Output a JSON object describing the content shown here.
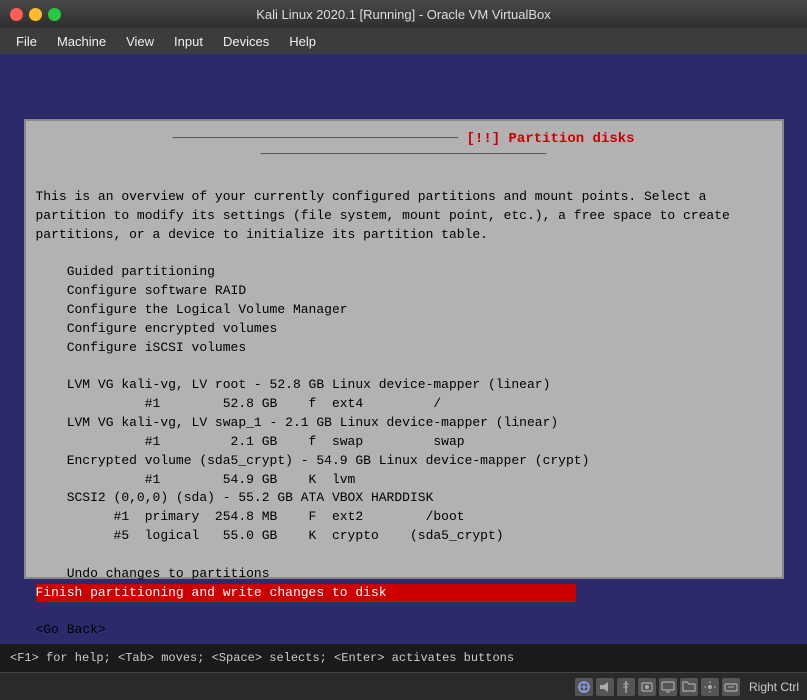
{
  "titlebar": {
    "title": "Kali Linux 2020.1 [Running] - Oracle VM VirtualBox"
  },
  "menubar": {
    "items": [
      "File",
      "Machine",
      "View",
      "Input",
      "Devices",
      "Help"
    ]
  },
  "terminal": {
    "title": "[!!] Partition disks",
    "description": "This is an overview of your currently configured partitions and mount points. Select a\npartition to modify its settings (file system, mount point, etc.), a free space to create\npartitions, or a device to initialize its partition table.",
    "options": [
      "Guided partitioning",
      "Configure software RAID",
      "Configure the Logical Volume Manager",
      "Configure encrypted volumes",
      "Configure iSCSI volumes",
      "",
      "LVM VG kali-vg, LV root - 52.8 GB Linux device-mapper (linear)",
      "        #1        52.8 GB    f  ext4         /",
      "LVM VG kali-vg, LV swap_1 - 2.1 GB Linux device-mapper (linear)",
      "        #1         2.1 GB    f  swap         swap",
      "Encrypted volume (sda5_crypt) - 54.9 GB Linux device-mapper (crypt)",
      "        #1        54.9 GB    K  lvm",
      "SCSI2 (0,0,0) (sda) - 55.2 GB ATA VBOX HARDDISK",
      "        #1  primary  254.8 MB    F  ext2        /boot",
      "        #5  logical   55.0 GB    K  crypto    (sda5_crypt)",
      "",
      "Undo changes to partitions"
    ],
    "highlighted": "Finish partitioning and write changes to disk",
    "go_back": "<Go Back>"
  },
  "statusbar": {
    "text": "<F1> for help; <Tab> moves; <Space> selects; <Enter> activates buttons"
  },
  "bottom_icons": {
    "right_ctrl": "Right Ctrl"
  }
}
